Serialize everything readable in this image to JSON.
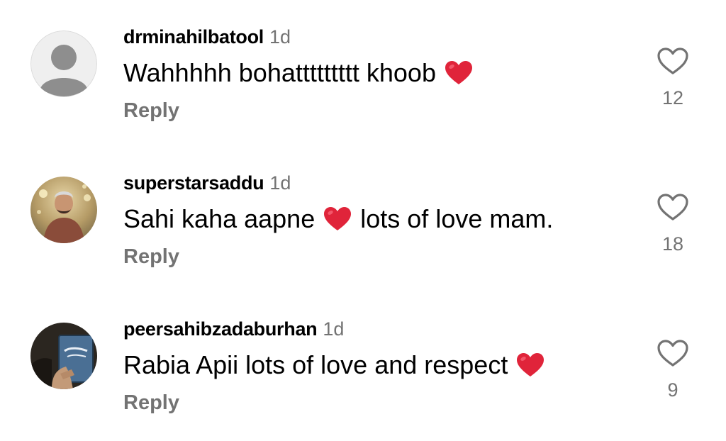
{
  "comments": [
    {
      "username": "drminahilbatool",
      "time": "1d",
      "text_before": "Wahhhhh bohattttttttt khoob",
      "text_after": "",
      "reply_label": "Reply",
      "likes": "12",
      "avatar_icon": "default-user-avatar"
    },
    {
      "username": "superstarsaddu",
      "time": "1d",
      "text_before": "Sahi kaha aapne",
      "text_after": "lots of love mam.",
      "reply_label": "Reply",
      "likes": "18",
      "avatar_icon": "user-photo-avatar"
    },
    {
      "username": "peersahibzadaburhan",
      "time": "1d",
      "text_before": "Rabia Apii lots of love and respect",
      "text_after": "",
      "reply_label": "Reply",
      "likes": "9",
      "avatar_icon": "user-photo-avatar"
    }
  ],
  "colors": {
    "text": "#000000",
    "secondary": "#737373",
    "heart_emoji": "#e0243a",
    "background": "#ffffff"
  },
  "icons": {
    "like": "heart-outline-icon",
    "emoji": "red-heart-emoji"
  }
}
